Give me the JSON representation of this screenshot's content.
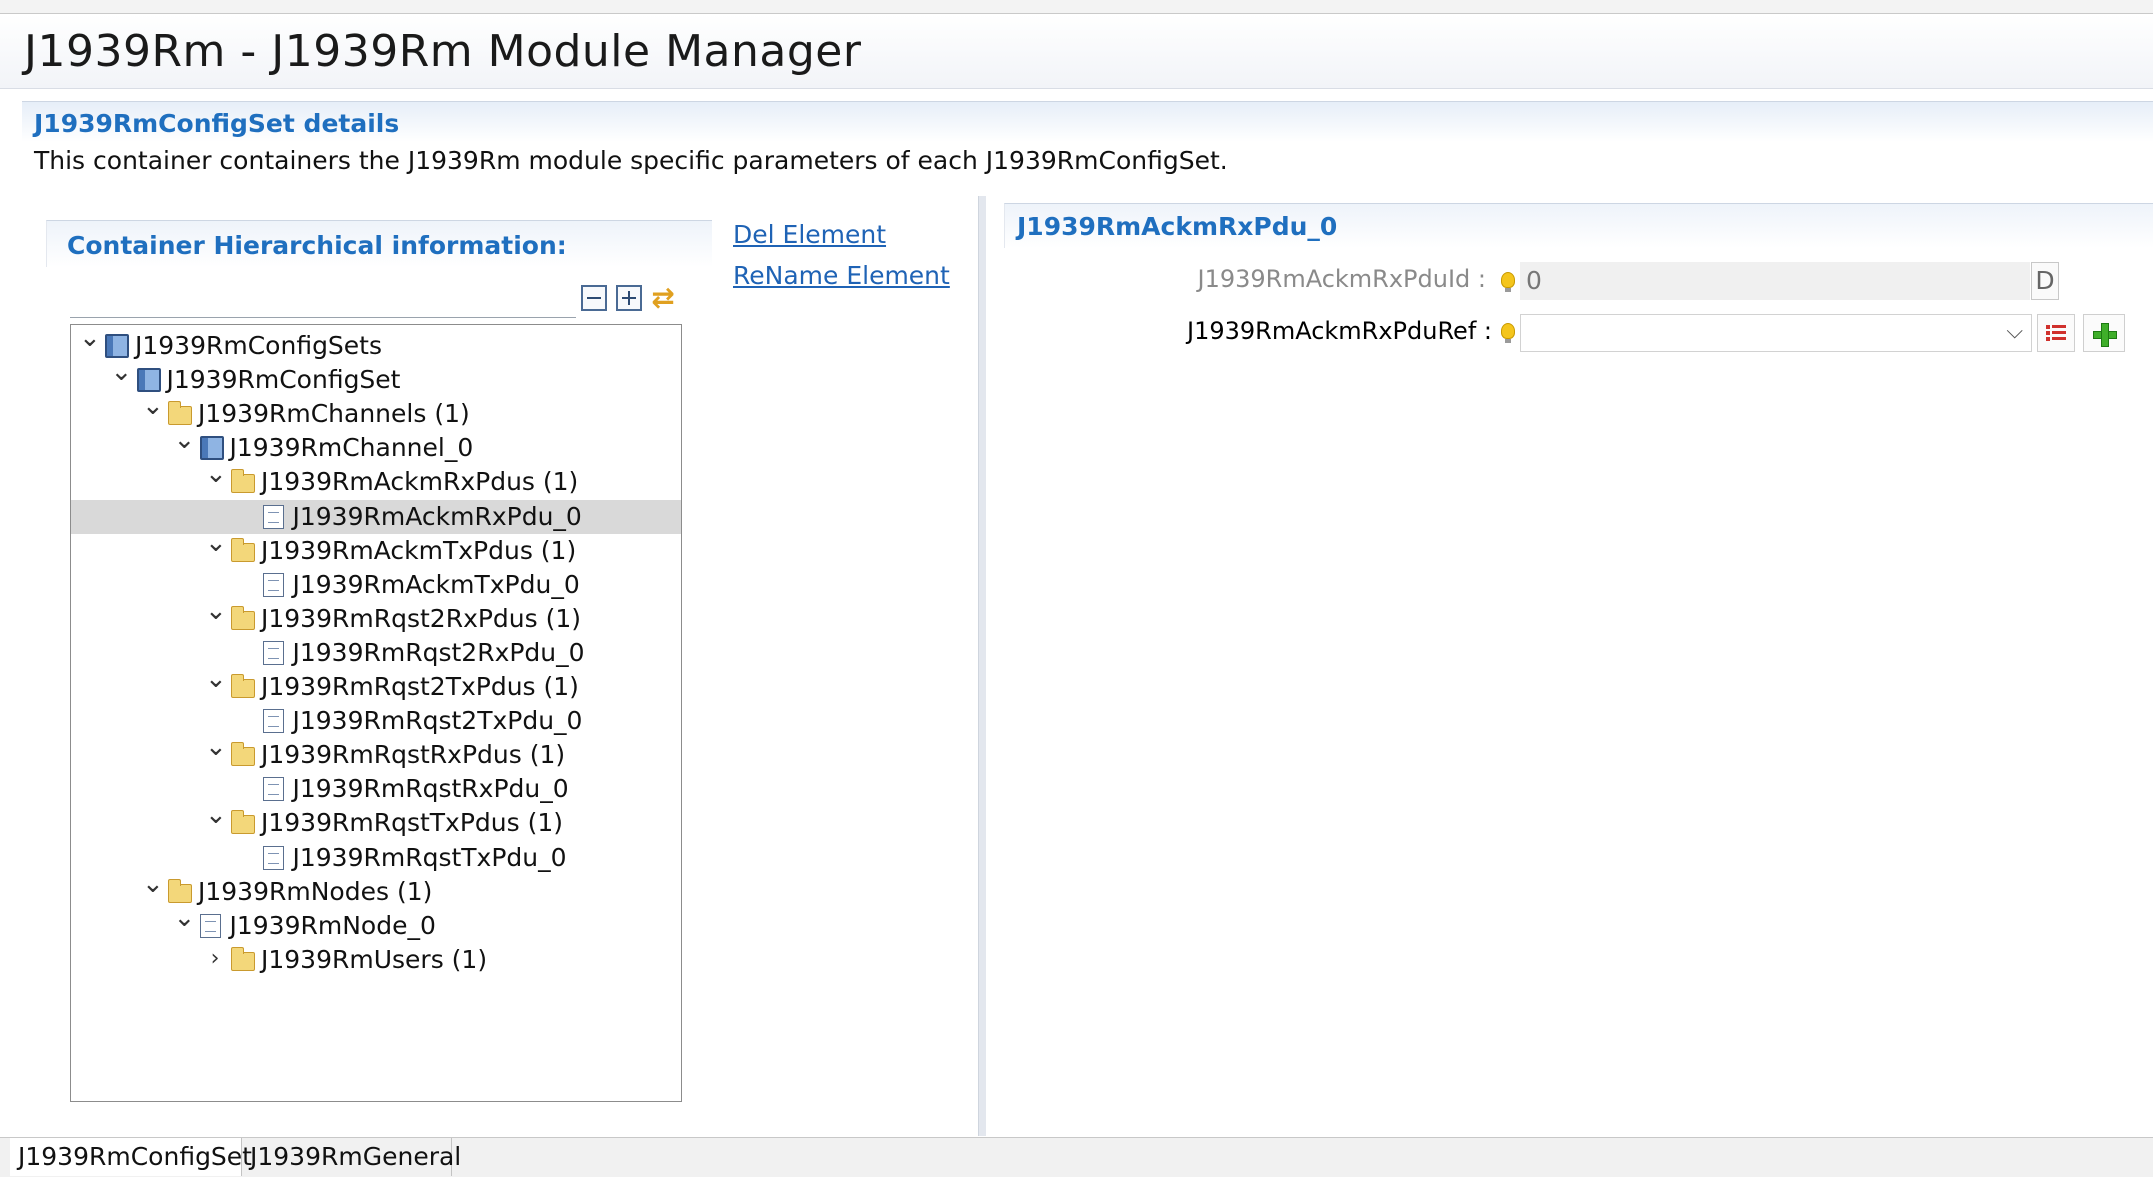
{
  "editor_tabs": [],
  "page": {
    "title": "J1939Rm - J1939Rm Module Manager"
  },
  "details": {
    "header": "J1939RmConfigSet details",
    "description": "This container containers the J1939Rm module specific parameters of each J1939RmConfigSet."
  },
  "hierarchy": {
    "header": "Container Hierarchical information:",
    "filter_value": "",
    "toolbar": {
      "collapse_icon": "collapse-all-icon",
      "expand_icon": "expand-all-icon",
      "sync_icon": "sync-icon"
    }
  },
  "actions": {
    "del_label": "Del Element",
    "rename_label": "ReName Element"
  },
  "tree": [
    {
      "label": "J1939RmConfigSets",
      "depth": 0,
      "icon": "container",
      "expander": "open",
      "selected": false
    },
    {
      "label": "J1939RmConfigSet",
      "depth": 1,
      "icon": "container",
      "expander": "open",
      "selected": false
    },
    {
      "label": "J1939RmChannels (1)",
      "depth": 2,
      "icon": "folder",
      "expander": "open",
      "selected": false
    },
    {
      "label": "J1939RmChannel_0",
      "depth": 3,
      "icon": "container",
      "expander": "open",
      "selected": false
    },
    {
      "label": "J1939RmAckmRxPdus (1)",
      "depth": 4,
      "icon": "folder",
      "expander": "open",
      "selected": false
    },
    {
      "label": "J1939RmAckmRxPdu_0",
      "depth": 5,
      "icon": "doc",
      "expander": "none",
      "selected": true
    },
    {
      "label": "J1939RmAckmTxPdus (1)",
      "depth": 4,
      "icon": "folder",
      "expander": "open",
      "selected": false
    },
    {
      "label": "J1939RmAckmTxPdu_0",
      "depth": 5,
      "icon": "doc",
      "expander": "none",
      "selected": false
    },
    {
      "label": "J1939RmRqst2RxPdus (1)",
      "depth": 4,
      "icon": "folder",
      "expander": "open",
      "selected": false
    },
    {
      "label": "J1939RmRqst2RxPdu_0",
      "depth": 5,
      "icon": "doc",
      "expander": "none",
      "selected": false
    },
    {
      "label": "J1939RmRqst2TxPdus (1)",
      "depth": 4,
      "icon": "folder",
      "expander": "open",
      "selected": false
    },
    {
      "label": "J1939RmRqst2TxPdu_0",
      "depth": 5,
      "icon": "doc",
      "expander": "none",
      "selected": false
    },
    {
      "label": "J1939RmRqstRxPdus (1)",
      "depth": 4,
      "icon": "folder",
      "expander": "open",
      "selected": false
    },
    {
      "label": "J1939RmRqstRxPdu_0",
      "depth": 5,
      "icon": "doc",
      "expander": "none",
      "selected": false
    },
    {
      "label": "J1939RmRqstTxPdus (1)",
      "depth": 4,
      "icon": "folder",
      "expander": "open",
      "selected": false
    },
    {
      "label": "J1939RmRqstTxPdu_0",
      "depth": 5,
      "icon": "doc",
      "expander": "none",
      "selected": false
    },
    {
      "label": "J1939RmNodes (1)",
      "depth": 2,
      "icon": "folder",
      "expander": "open",
      "selected": false
    },
    {
      "label": "J1939RmNode_0",
      "depth": 3,
      "icon": "doc",
      "expander": "open",
      "selected": false
    },
    {
      "label": "J1939RmUsers (1)",
      "depth": 4,
      "icon": "folder",
      "expander": "closed",
      "selected": false
    }
  ],
  "properties": {
    "header": "J1939RmAckmRxPdu_0",
    "pdu_id_label": "J1939RmAckmRxPduId :",
    "pdu_id_value": "0",
    "pdu_id_default_btn": "D",
    "pdu_ref_label": "J1939RmAckmRxPduRef :",
    "pdu_ref_value": ""
  },
  "bottom_tabs": [
    {
      "label": "J1939RmConfigSet",
      "active": true
    },
    {
      "label": "J1939RmGeneral",
      "active": false
    }
  ],
  "colors": {
    "accent": "#1f6fbf",
    "link": "#1f63b5",
    "selection": "#d9d9d9"
  }
}
